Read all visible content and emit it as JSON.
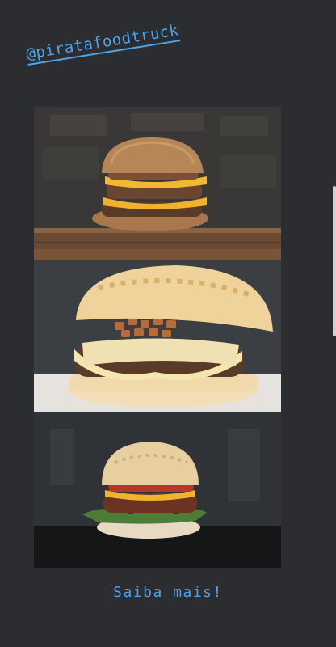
{
  "story": {
    "handle": "@piratafoodtruck",
    "cta": "Saiba mais!"
  },
  "colors": {
    "background": "#2b2d31",
    "link": "#4fa3e8"
  }
}
